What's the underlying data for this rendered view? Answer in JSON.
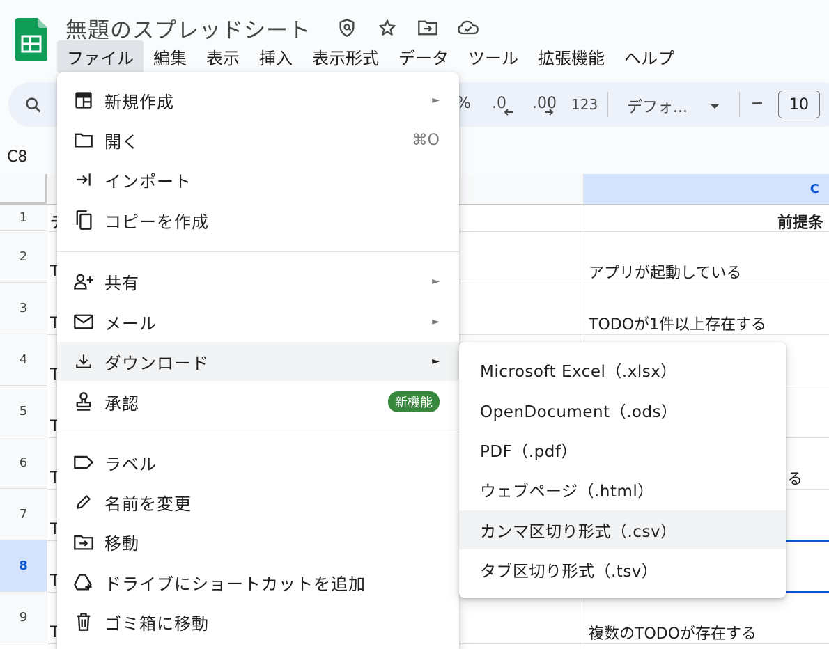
{
  "app": {
    "doc_title": "無題のスプレッドシート",
    "title_icons": [
      "privacy-shield-icon",
      "star-icon",
      "move-folder-icon",
      "cloud-status-icon"
    ],
    "brand_color": "#0f9d58"
  },
  "menubar": {
    "items": [
      "ファイル",
      "編集",
      "表示",
      "挿入",
      "表示形式",
      "データ",
      "ツール",
      "拡張機能",
      "ヘルプ"
    ],
    "active": "ファイル"
  },
  "toolbar": {
    "percent": "%",
    "decrease_decimal": ".0",
    "increase_decimal": ".00",
    "number_format": "123",
    "font_name": "デフォ...",
    "minus": "−",
    "font_size": "10"
  },
  "namebox": "C8",
  "grid": {
    "column_c_label": "C",
    "rows": [
      {
        "num": "1",
        "a": "テ",
        "c": "前提条"
      },
      {
        "num": "2",
        "a": "T",
        "c": "アプリが起動している"
      },
      {
        "num": "3",
        "a": "T",
        "c": "TODOが1件以上存在する"
      },
      {
        "num": "4",
        "a": "T",
        "c": ""
      },
      {
        "num": "5",
        "a": "T",
        "c": ""
      },
      {
        "num": "6",
        "a": "T",
        "c": "る"
      },
      {
        "num": "7",
        "a": "T",
        "c": ""
      },
      {
        "num": "8",
        "a": "T",
        "c": ""
      },
      {
        "num": "9",
        "a": "T",
        "c": "複数のTODOが存在する"
      }
    ],
    "selected_row": "8"
  },
  "file_menu": {
    "new": {
      "label": "新規作成",
      "arrow": "►"
    },
    "open": {
      "label": "開く",
      "shortcut": "⌘O"
    },
    "import": {
      "label": "インポート"
    },
    "copy": {
      "label": "コピーを作成"
    },
    "share": {
      "label": "共有",
      "arrow": "►"
    },
    "email": {
      "label": "メール",
      "arrow": "►"
    },
    "download": {
      "label": "ダウンロード",
      "arrow": "►"
    },
    "approval": {
      "label": "承認",
      "badge": "新機能"
    },
    "label": {
      "label": "ラベル"
    },
    "rename": {
      "label": "名前を変更"
    },
    "move": {
      "label": "移動"
    },
    "shortcut": {
      "label": "ドライブにショートカットを追加"
    },
    "trash": {
      "label": "ゴミ箱に移動"
    }
  },
  "download_submenu": {
    "items": [
      "Microsoft Excel（.xlsx）",
      "OpenDocument（.ods）",
      "PDF（.pdf）",
      "ウェブページ（.html）",
      "カンマ区切り形式（.csv）",
      "タブ区切り形式（.tsv）"
    ],
    "hovered_index": 4
  }
}
